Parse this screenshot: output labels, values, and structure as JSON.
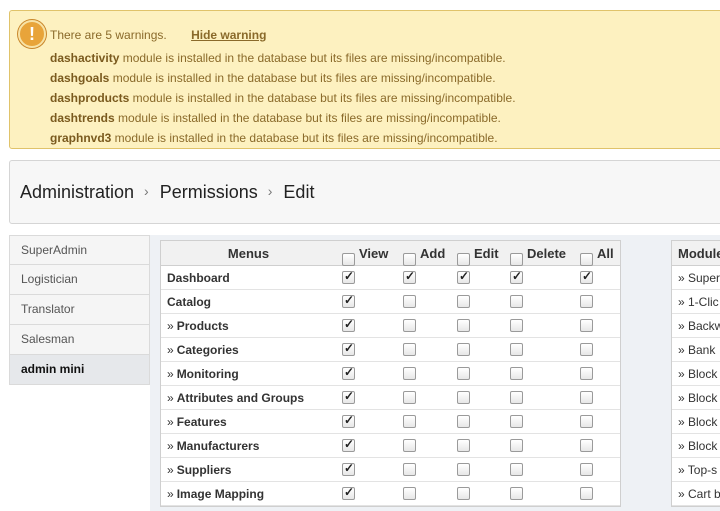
{
  "warnings": {
    "header": "There are 5 warnings.",
    "hide_label": "Hide warning",
    "icon": "!",
    "items": [
      {
        "module": "dashactivity",
        "text": " module is installed in the database but its files are missing/incompatible."
      },
      {
        "module": "dashgoals",
        "text": " module is installed in the database but its files are missing/incompatible."
      },
      {
        "module": "dashproducts",
        "text": " module is installed in the database but its files are missing/incompatible."
      },
      {
        "module": "dashtrends",
        "text": " module is installed in the database but its files are missing/incompatible."
      },
      {
        "module": "graphnvd3",
        "text": " module is installed in the database but its files are missing/incompatible."
      }
    ]
  },
  "breadcrumb": {
    "items": [
      "Administration",
      "Permissions",
      "Edit"
    ],
    "separator": "›"
  },
  "profiles": [
    {
      "label": "SuperAdmin",
      "active": false
    },
    {
      "label": "Logistician",
      "active": false
    },
    {
      "label": "Translator",
      "active": false
    },
    {
      "label": "Salesman",
      "active": false
    },
    {
      "label": "admin mini",
      "active": true
    }
  ],
  "menus_table": {
    "header": "Menus",
    "columns": [
      "View",
      "Add",
      "Edit",
      "Delete",
      "All"
    ],
    "sub_prefix": "»",
    "rows": [
      {
        "label": "Dashboard",
        "sub": false,
        "checks": [
          true,
          true,
          true,
          true,
          true
        ]
      },
      {
        "label": "Catalog",
        "sub": false,
        "checks": [
          true,
          false,
          false,
          false,
          false
        ]
      },
      {
        "label": "Products",
        "sub": true,
        "checks": [
          true,
          false,
          false,
          false,
          false
        ]
      },
      {
        "label": "Categories",
        "sub": true,
        "checks": [
          true,
          false,
          false,
          false,
          false
        ]
      },
      {
        "label": "Monitoring",
        "sub": true,
        "checks": [
          true,
          false,
          false,
          false,
          false
        ]
      },
      {
        "label": "Attributes and Groups",
        "sub": true,
        "checks": [
          true,
          false,
          false,
          false,
          false
        ]
      },
      {
        "label": "Features",
        "sub": true,
        "checks": [
          true,
          false,
          false,
          false,
          false
        ]
      },
      {
        "label": "Manufacturers",
        "sub": true,
        "checks": [
          true,
          false,
          false,
          false,
          false
        ]
      },
      {
        "label": "Suppliers",
        "sub": true,
        "checks": [
          true,
          false,
          false,
          false,
          false
        ]
      },
      {
        "label": "Image Mapping",
        "sub": true,
        "checks": [
          true,
          false,
          false,
          false,
          false
        ]
      }
    ]
  },
  "modules_table": {
    "header": "Module",
    "items": [
      "» Super",
      "» 1-Clic",
      "» Backw",
      "» Bank",
      "» Block",
      "» Block",
      "» Block",
      "» Block",
      "» Top-s",
      "» Cart b"
    ]
  }
}
